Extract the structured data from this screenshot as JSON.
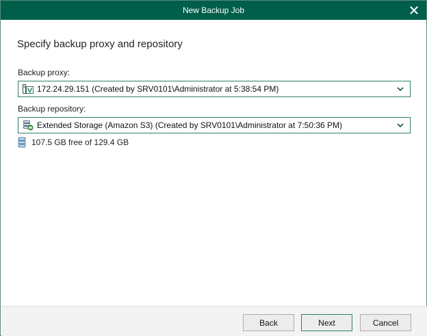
{
  "window": {
    "title": "New Backup Job"
  },
  "page": {
    "heading": "Specify backup proxy and repository"
  },
  "proxy": {
    "label": "Backup proxy:",
    "selected": "172.24.29.151 (Created by SRV0101\\Administrator at 5:38:54 PM)",
    "icon": "server-proxy-icon"
  },
  "repository": {
    "label": "Backup repository:",
    "selected": "Extended Storage (Amazon S3) (Created by SRV0101\\Administrator at 7:50:36 PM)",
    "icon": "storage-repository-icon",
    "free_space": "107.5 GB free of 129.4 GB"
  },
  "footer": {
    "back_label": "Back",
    "next_label": "Next",
    "cancel_label": "Cancel"
  },
  "colors": {
    "titlebar": "#005f4b",
    "accent_border": "#2e7d6b"
  }
}
